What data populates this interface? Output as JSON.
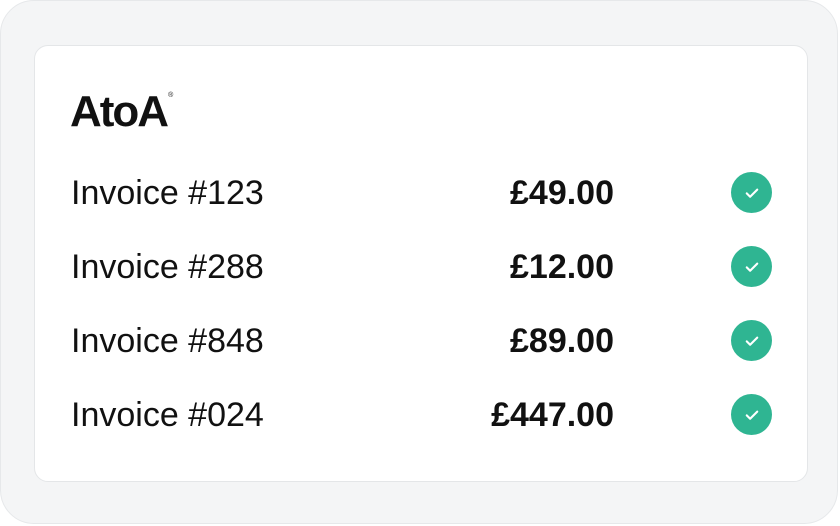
{
  "brand": {
    "logo_text": "AtoA",
    "registered_mark": "®"
  },
  "invoices": [
    {
      "label": "Invoice #123",
      "amount": "£49.00",
      "status_icon": "check-circle-icon"
    },
    {
      "label": "Invoice #288",
      "amount": "£12.00",
      "status_icon": "check-circle-icon"
    },
    {
      "label": "Invoice #848",
      "amount": "£89.00",
      "status_icon": "check-circle-icon"
    },
    {
      "label": "Invoice #024",
      "amount": "£447.00",
      "status_icon": "check-circle-icon"
    }
  ],
  "colors": {
    "status_success": "#2fb592",
    "text_primary": "#111111",
    "frame_background": "#f4f5f6",
    "card_background": "#ffffff"
  }
}
